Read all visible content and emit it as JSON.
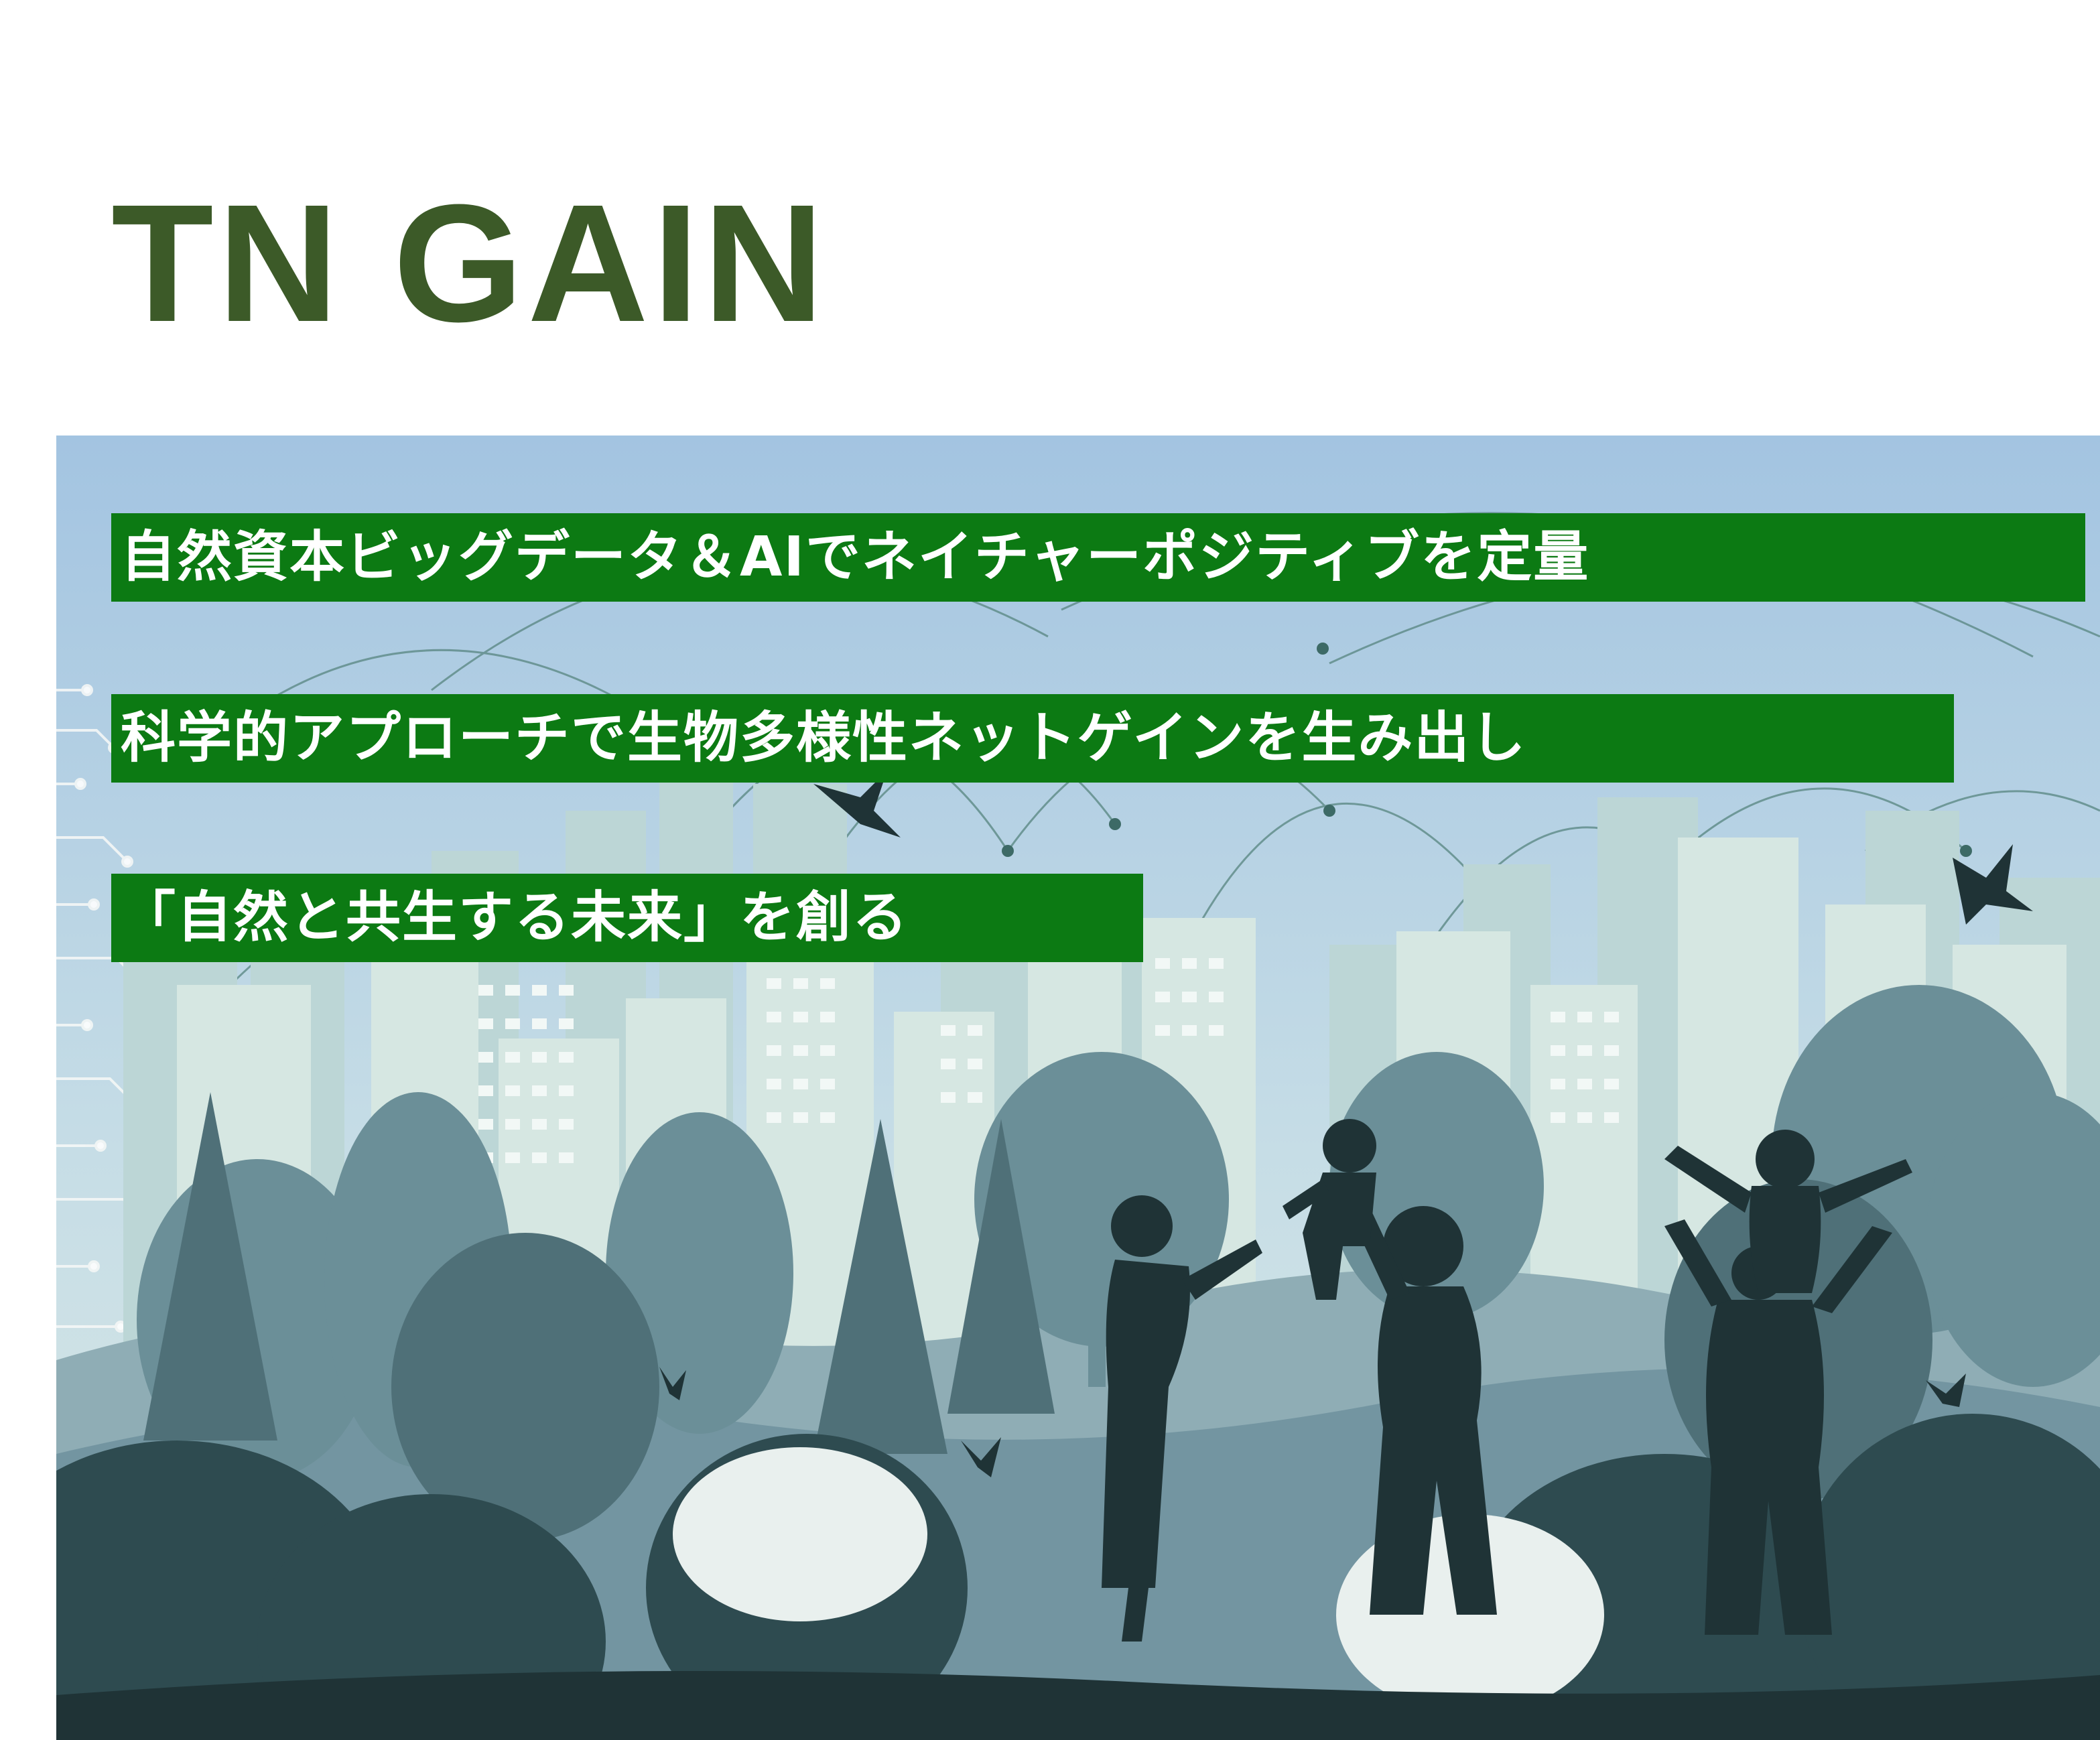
{
  "header": {
    "title": "TN GAIN"
  },
  "hero": {
    "taglines": [
      "自然資本ビッグデータ＆AIでネイチャーポジティブを定量",
      "科学的アプローチで生物多様性ネットゲインを生み出し",
      "「自然と共生する未来」を創る"
    ]
  },
  "colors": {
    "brand": "#3c5a28",
    "tagline_bg": "#0c7a13",
    "tagline_text": "#ffffff",
    "sky_top": "#a3c4e1",
    "sky_bottom": "#dbe9e4",
    "silhouette": "#1f3336"
  }
}
